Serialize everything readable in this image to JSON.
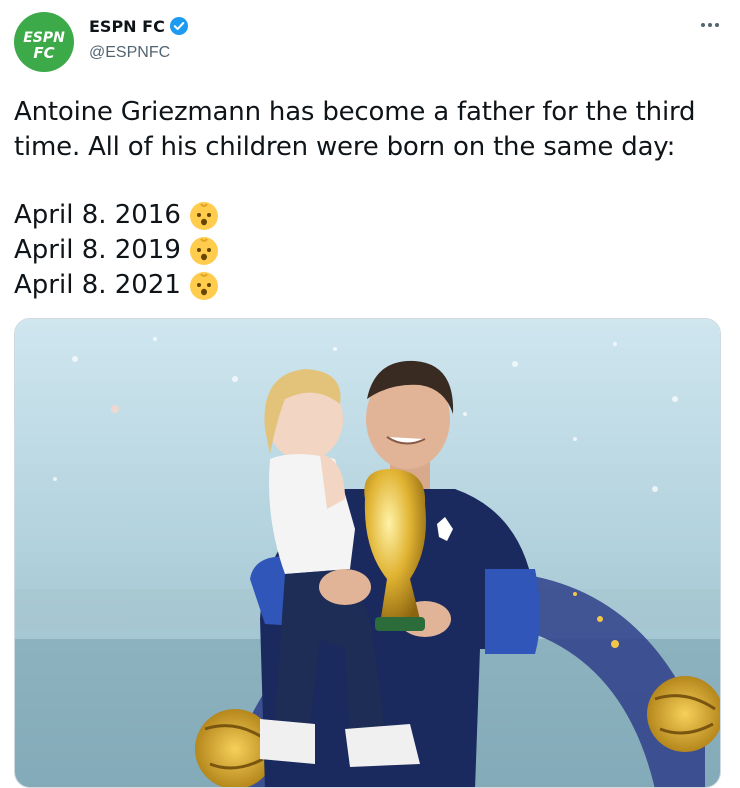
{
  "account": {
    "display_name": "ESPN FC",
    "handle": "@ESPNFC",
    "logo_text_top": "ESPN",
    "logo_text_bottom": "FC",
    "logo_color": "#3daa4a",
    "verified": true
  },
  "tweet": {
    "line1": "Antoine Griezmann has become a father for the third",
    "line2": "time. All of his children were born on the same day:",
    "dates": [
      {
        "label": "April 8. 2016",
        "emoji": "baby-icon"
      },
      {
        "label": "April 8. 2019",
        "emoji": "baby-icon"
      },
      {
        "label": "April 8. 2021",
        "emoji": "baby-icon"
      }
    ]
  },
  "icons": {
    "more": "more-horizontal-icon",
    "verified": "verified-badge-icon"
  },
  "colors": {
    "text": "#0f1419",
    "secondary": "#536471",
    "verified_blue": "#1d9bf0",
    "france_blue": "#1b2a5e"
  }
}
